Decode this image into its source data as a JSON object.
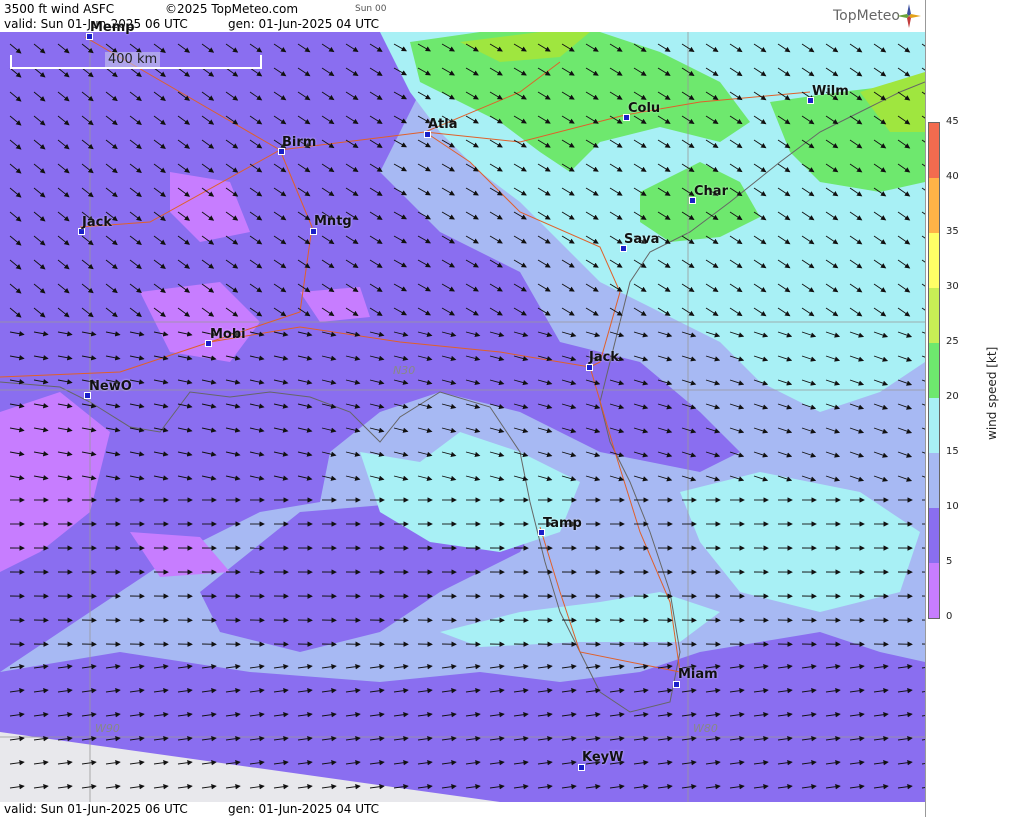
{
  "header": {
    "product": "3500 ft wind ASFC",
    "copyright": "©2025 TopMeteo.com",
    "run": "Sun 00",
    "valid": "valid:  Sun  01-Jun-2025  06 UTC",
    "gen": "gen: 01-Jun-2025 04 UTC"
  },
  "footer": {
    "valid": "valid:  Sun  01-Jun-2025  06 UTC",
    "gen": "gen: 01-Jun-2025 04 UTC"
  },
  "logo": {
    "text": "TopMeteo",
    "icon": "compass-star-icon"
  },
  "scale": {
    "label": "400 km"
  },
  "cities": [
    "Memp",
    "Birm",
    "Atla",
    "Colu",
    "Wilm",
    "Jack",
    "Mntg",
    "Char",
    "Sava",
    "Mobi",
    "NewO",
    "Jack",
    "Tamp",
    "Miam",
    "KeyW"
  ],
  "grid_labels": [
    "N30",
    "W90",
    "W80"
  ],
  "legend": {
    "title": "wind speed [kt]",
    "ticks": [
      "45",
      "40",
      "35",
      "30",
      "25",
      "20",
      "15",
      "10",
      "5",
      "0"
    ],
    "colors": {
      "0-5": "#c77dff",
      "5-10": "#8a6ef0",
      "10-15": "#a7b9f3",
      "15-20": "#a8f0f5",
      "20-25": "#6ee86e",
      "25-30": "#9fe63f",
      "30-35": "#ffff66",
      "35-40": "#ffb347",
      "40-45": "#f26b4f"
    }
  }
}
